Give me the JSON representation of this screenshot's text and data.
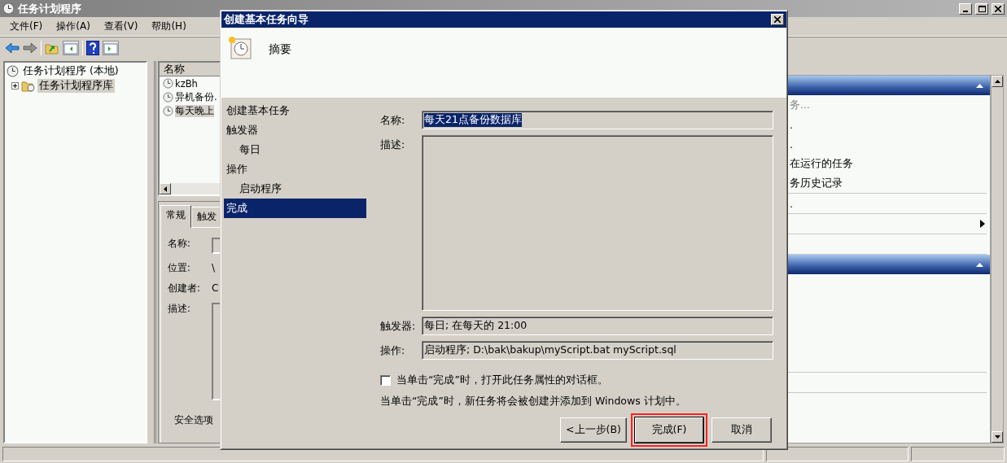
{
  "window": {
    "title": "任务计划程序"
  },
  "menu": [
    {
      "label": "文件(F)"
    },
    {
      "label": "操作(A)"
    },
    {
      "label": "查看(V)"
    },
    {
      "label": "帮助(H)"
    }
  ],
  "tree": [
    {
      "label": "任务计划程序 (本地)",
      "selected": false,
      "children": [
        {
          "label": "任务计划程序库",
          "selected": true,
          "expanded": false
        }
      ]
    }
  ],
  "task_list": {
    "columns": [
      "名称"
    ],
    "rows": [
      {
        "name": "kzBh",
        "selected": false
      },
      {
        "name": "异机备份.",
        "selected": false
      },
      {
        "name": "每天晚上",
        "selected": true
      }
    ]
  },
  "detail_tabs": [
    {
      "label": "常规",
      "selected": true
    },
    {
      "label": "触发",
      "selected": false
    }
  ],
  "detail_fields": [
    {
      "label": "名称:",
      "kind": "field"
    },
    {
      "label": "位置:",
      "value": "\\",
      "kind": "text"
    },
    {
      "label": "创建者:",
      "value": "C",
      "kind": "text"
    },
    {
      "label": "描述:",
      "kind": "area"
    }
  ],
  "security_label": "安全选项",
  "actions_panel": {
    "sections": [
      {
        "items": [
          {
            "kind": "action",
            "label": "务...",
            "disabled": true
          },
          {
            "kind": "action",
            "label": ".",
            "disabled": false
          },
          {
            "kind": "action",
            "label": ".",
            "disabled": false
          },
          {
            "kind": "action",
            "label": "在运行的任务",
            "disabled": false
          },
          {
            "kind": "action",
            "label": "务历史记录",
            "disabled": false
          },
          {
            "kind": "separator"
          },
          {
            "kind": "action",
            "label": ".",
            "disabled": false
          },
          {
            "kind": "separator"
          },
          {
            "kind": "submenu"
          },
          {
            "kind": "separator"
          },
          {
            "kind": "spacer"
          },
          {
            "kind": "separator"
          }
        ]
      },
      {
        "items": [
          {
            "kind": "spacer"
          },
          {
            "kind": "spacer"
          },
          {
            "kind": "spacer"
          },
          {
            "kind": "spacer"
          },
          {
            "kind": "spacer"
          },
          {
            "kind": "separator"
          },
          {
            "kind": "spacer"
          },
          {
            "kind": "separator"
          }
        ]
      }
    ]
  },
  "dialog": {
    "title": "创建基本任务向导",
    "heading": "摘要",
    "steps": [
      {
        "label": "创建基本任务",
        "selected": false
      },
      {
        "label": "触发器",
        "selected": false,
        "children": [
          {
            "label": "每日",
            "selected": false
          }
        ]
      },
      {
        "label": "操作",
        "selected": false,
        "children": [
          {
            "label": "启动程序",
            "selected": false
          }
        ]
      },
      {
        "label": "完成",
        "selected": true
      }
    ],
    "fields": [
      {
        "label": "名称:",
        "kind": "line",
        "value": "每天21点备份数据库",
        "text_selected": true
      },
      {
        "label": "描述:",
        "kind": "area"
      },
      {
        "label": "触发器:",
        "kind": "line",
        "value": "每日; 在每天的 21:00",
        "text_selected": false
      },
      {
        "label": "操作:",
        "kind": "line",
        "value": "启动程序; D:\\bak\\bakup\\myScript.bat myScript.sql",
        "text_selected": false
      }
    ],
    "open_properties": {
      "label": "当单击“完成”时，打开此任务属性的对话框。",
      "checked": false
    },
    "note": "当单击“完成”时，新任务将会被创建并添加到 Windows 计划中。",
    "buttons": [
      {
        "label": "<上一步(B)",
        "highlighted": false
      },
      {
        "label": "完成(F)",
        "highlighted": true
      },
      {
        "label": "取消",
        "highlighted": false
      }
    ]
  }
}
